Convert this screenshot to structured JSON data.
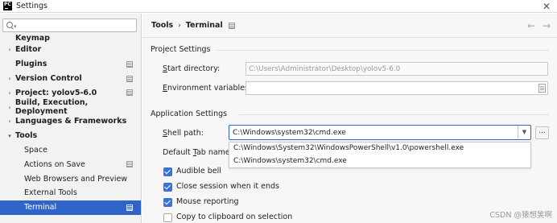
{
  "window": {
    "title": "Settings",
    "logo_text": "PC"
  },
  "sidebar": {
    "search": {
      "value": "",
      "placeholder": ""
    },
    "items": [
      {
        "label": "Keymap",
        "bold": true,
        "arrow": "",
        "cut": true
      },
      {
        "label": "Editor",
        "bold": true,
        "arrow": "right"
      },
      {
        "label": "Plugins",
        "bold": true,
        "arrow": "",
        "project_icon": true
      },
      {
        "label": "Version Control",
        "bold": true,
        "arrow": "right",
        "project_icon": true
      },
      {
        "label": "Project: yolov5-6.0",
        "bold": true,
        "arrow": "right",
        "project_icon": true
      },
      {
        "label": "Build, Execution, Deployment",
        "bold": true,
        "arrow": "right"
      },
      {
        "label": "Languages & Frameworks",
        "bold": true,
        "arrow": "right"
      },
      {
        "label": "Tools",
        "bold": true,
        "arrow": "down"
      },
      {
        "label": "Space",
        "child": true
      },
      {
        "label": "Actions on Save",
        "child": true,
        "project_icon": true
      },
      {
        "label": "Web Browsers and Preview",
        "child": true
      },
      {
        "label": "External Tools",
        "child": true
      },
      {
        "label": "Terminal",
        "child": true,
        "selected": true,
        "project_icon": true
      }
    ]
  },
  "header": {
    "crumb_1": "Tools",
    "separator": "›",
    "crumb_2": "Terminal",
    "back": "←",
    "forward": "→"
  },
  "project_settings": {
    "title": "Project Settings",
    "start_dir_label_u": "S",
    "start_dir_label_rest": "tart directory:",
    "start_dir_value": "C:\\Users\\Administrator\\Desktop\\yolov5-6.0",
    "env_label_u": "E",
    "env_label_rest": "nvironment variables:",
    "env_value": ""
  },
  "app_settings": {
    "title": "Application Settings",
    "shell_label_u": "S",
    "shell_label_rest": "hell path:",
    "shell_value": "C:\\Windows\\system32\\cmd.exe",
    "browse_label": "...",
    "tab_label_pre": "Default ",
    "tab_label_u": "T",
    "tab_label_rest": "ab name:",
    "dropdown_options": [
      "C:\\Windows\\System32\\WindowsPowerShell\\v1.0\\powershell.exe",
      "C:\\Windows\\system32\\cmd.exe"
    ],
    "checkboxes": [
      {
        "label": "Audible bell",
        "checked": true
      },
      {
        "label": "Close session when it ends",
        "checked": true
      },
      {
        "label": "Mouse reporting",
        "checked": true
      },
      {
        "label": "Copy to clipboard on selection",
        "checked": false
      }
    ]
  },
  "watermark": "CSDN @猿想笑啊",
  "colors": {
    "accent": "#2f65ca",
    "checkbox": "#3873d7",
    "sidebar_bg": "#f2f2f2",
    "panel_bg": "#f7f7f7"
  }
}
